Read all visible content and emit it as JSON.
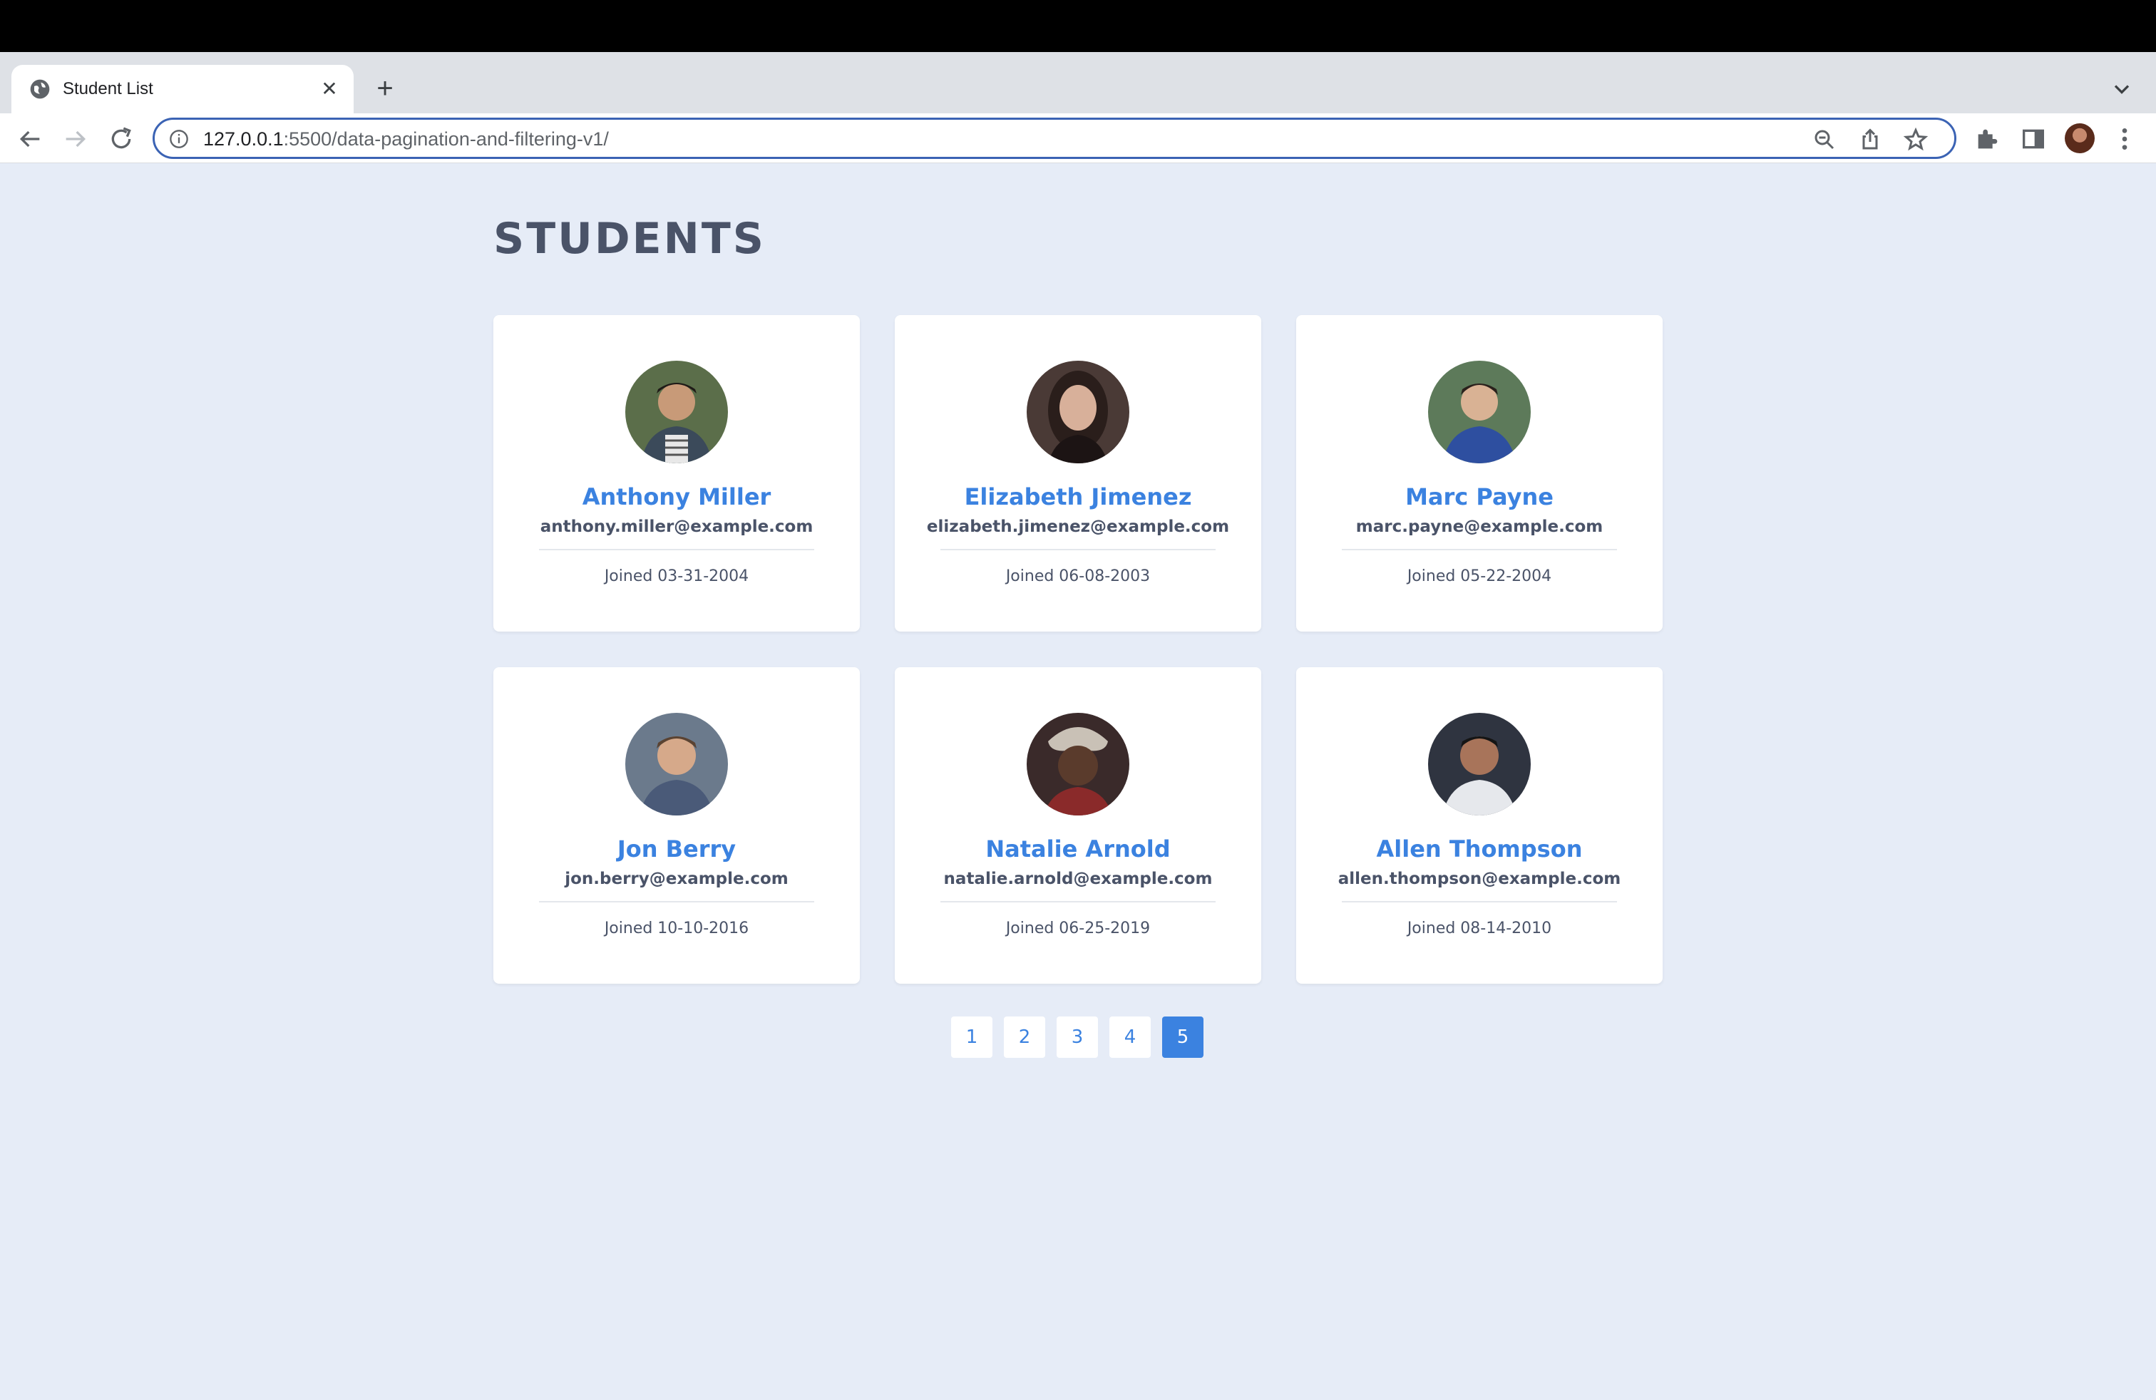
{
  "browser": {
    "tab_title": "Student List",
    "url_host": "127.0.0.1",
    "url_rest": ":5500/data-pagination-and-filtering-v1/"
  },
  "page": {
    "title": "STUDENTS"
  },
  "students": [
    {
      "name": "Anthony Miller",
      "email": "anthony.miller@example.com",
      "joined": "Joined 03-31-2004",
      "avatar_color": "#5b6e4a"
    },
    {
      "name": "Elizabeth Jimenez",
      "email": "elizabeth.jimenez@example.com",
      "joined": "Joined 06-08-2003",
      "avatar_color": "#4a3a36"
    },
    {
      "name": "Marc Payne",
      "email": "marc.payne@example.com",
      "joined": "Joined 05-22-2004",
      "avatar_color": "#3d5a7a"
    },
    {
      "name": "Jon Berry",
      "email": "jon.berry@example.com",
      "joined": "Joined 10-10-2016",
      "avatar_color": "#6b7a8c"
    },
    {
      "name": "Natalie Arnold",
      "email": "natalie.arnold@example.com",
      "joined": "Joined 06-25-2019",
      "avatar_color": "#3a2a2a"
    },
    {
      "name": "Allen Thompson",
      "email": "allen.thompson@example.com",
      "joined": "Joined 08-14-2010",
      "avatar_color": "#2f3440"
    }
  ],
  "pagination": {
    "pages": [
      "1",
      "2",
      "3",
      "4",
      "5"
    ],
    "current": "5"
  },
  "colors": {
    "accent": "#3b82e0",
    "background": "#e6ecf7"
  }
}
